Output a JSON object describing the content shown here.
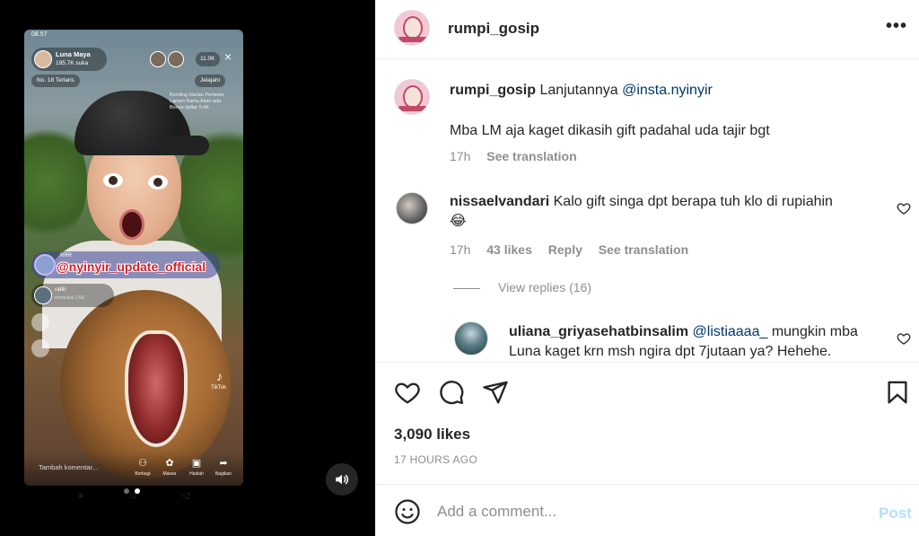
{
  "post": {
    "username": "rumpi_gosip",
    "more_icon": "more-horizontal-icon"
  },
  "media": {
    "status_time": "08.57",
    "live_host_name": "Luna Maya",
    "live_host_likes": "195.7K suka",
    "viewer_count": "11.0K",
    "rank_label": "No. 18 Terlaris",
    "explore_label": "Jelajahi",
    "overlay_note": "Bonding Harian Pertama Laman Kamu Akan ada Bonus daftar 5.4K",
    "watermark_small": "RRR",
    "watermark_handle": "@nyinyir_update_official",
    "chat_name": "ratih",
    "chat_sub": "menyukai LIVE",
    "tiktok_label": "TikTok",
    "comment_hint": "Tambah komentar...",
    "actions": [
      "Berbagi",
      "Mawar",
      "Hadiah",
      "Bagikan"
    ],
    "mute_icon": "volume-icon",
    "carousel_active_index": 1
  },
  "caption": {
    "username": "rumpi_gosip",
    "text": "Lanjutannya ",
    "mention": "@insta.nyinyir",
    "body": "Mba LM aja kaget dikasih gift padahal uda tajir bgt",
    "time": "17h",
    "see_translation": "See translation"
  },
  "comments": [
    {
      "username": "nissaelvandari",
      "text": "Kalo gift singa dpt berapa tuh klo di rupiahin",
      "emoji": "😂",
      "time": "17h",
      "likes": "43 likes",
      "reply": "Reply",
      "see_translation": "See translation",
      "view_replies": "View replies (16)"
    }
  ],
  "reply": {
    "username": "uliana_griyasehatbinsalim",
    "mention": "@listiaaaa_",
    "text_line1": " mungkin mba",
    "text_line2": "Luna kaget krn msh ngira dpt 7jutaan ya? Hehehe."
  },
  "actions": {
    "like_icon": "heart-icon",
    "comment_icon": "comment-icon",
    "share_icon": "send-icon",
    "save_icon": "bookmark-icon",
    "likes": "3,090 likes",
    "timestamp": "17 HOURS AGO"
  },
  "compose": {
    "emoji_icon": "emoji-icon",
    "placeholder": "Add a comment...",
    "post_label": "Post"
  },
  "colors": {
    "link": "#00376b",
    "secondary_text": "#8e8e8e",
    "post_disabled": "#b2dffc",
    "watermark_red": "#d81e2a"
  }
}
